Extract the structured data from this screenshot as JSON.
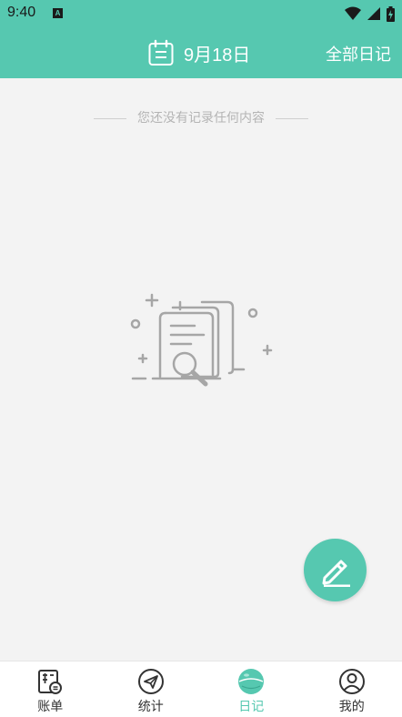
{
  "status_bar": {
    "time": "9:40",
    "app_badge": "A"
  },
  "header": {
    "date": "9月18日",
    "all_diary_label": "全部日记"
  },
  "empty_state": {
    "message": "您还没有记录任何内容"
  },
  "tabs": [
    {
      "label": "账单",
      "icon": "bill-icon"
    },
    {
      "label": "统计",
      "icon": "paper-plane-icon"
    },
    {
      "label": "日记",
      "icon": "diary-icon",
      "active": true
    },
    {
      "label": "我的",
      "icon": "profile-icon"
    }
  ],
  "colors": {
    "accent": "#56c8b0",
    "background": "#f3f3f3"
  }
}
